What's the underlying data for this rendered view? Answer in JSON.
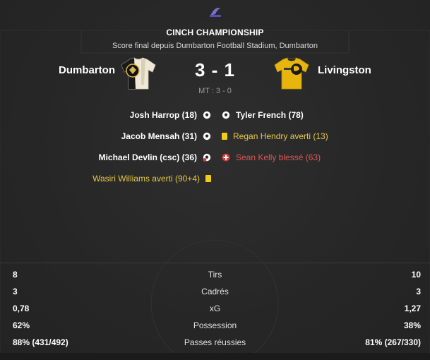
{
  "header": {
    "competition": "CINCH CHAMPIONSHIP",
    "subtitle": "Score final depuis Dumbarton Football Stadium, Dumbarton"
  },
  "match": {
    "home_team": "Dumbarton",
    "away_team": "Livingston",
    "score": "3 - 1",
    "half_time": "MT : 3 - 0"
  },
  "events": {
    "home": [
      {
        "text": "Josh Harrop (18)",
        "icon": "goal-ball-icon"
      },
      {
        "text": "Jacob Mensah (31)",
        "icon": "goal-ball-icon"
      },
      {
        "text": "Michael Devlin (csc)",
        "minute": "(36)",
        "icon": "own-goal-ball-icon"
      },
      {
        "text": "Wasiri Williams averti (90+4)",
        "icon": "yellow-card-icon"
      }
    ],
    "away": [
      {
        "text": "Tyler French (78)",
        "icon": "goal-ball-icon"
      },
      {
        "text": "Regan Hendry averti (13)",
        "icon": "yellow-card-icon"
      },
      {
        "text": "Sean Kelly blessé (63)",
        "icon": "injury-icon"
      }
    ]
  },
  "stats": [
    {
      "label": "Tirs",
      "home": "8",
      "away": "10"
    },
    {
      "label": "Cadrés",
      "home": "3",
      "away": "3"
    },
    {
      "label": "xG",
      "home": "0,78",
      "away": "1,27"
    },
    {
      "label": "Possession",
      "home": "62%",
      "away": "38%"
    },
    {
      "label": "Passes réussies",
      "home": "88% (431/492)",
      "away": "81% (267/330)"
    }
  ],
  "colors": {
    "background": "#262626",
    "yellow_card": "#f2cc1a",
    "warning_text": "#e6c84a",
    "injury_text": "#e05656"
  }
}
